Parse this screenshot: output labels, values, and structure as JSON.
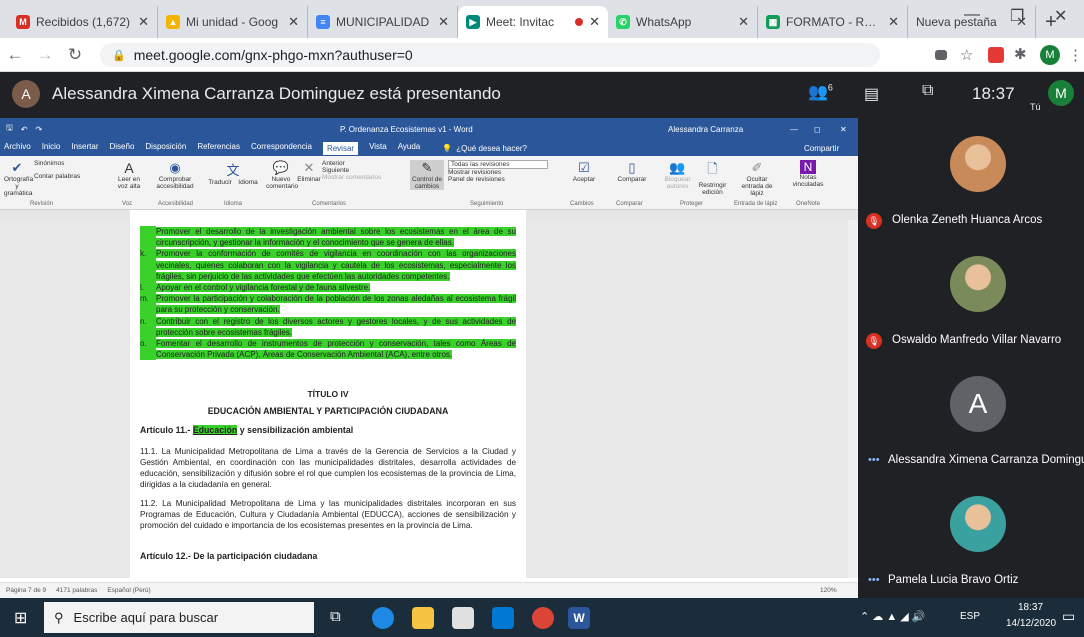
{
  "browser": {
    "tabs": [
      {
        "title": "Recibidos (1,672)",
        "icon": "gmail-icon",
        "color": "#d93025",
        "glyph": "M"
      },
      {
        "title": "Mi unidad - Goog",
        "icon": "drive-icon",
        "color": "#f4b400",
        "glyph": "▲"
      },
      {
        "title": "MUNICIPALIDAD",
        "icon": "docs-icon",
        "color": "#4285f4",
        "glyph": "≡"
      },
      {
        "title": "Meet: Invitac",
        "icon": "meet-icon",
        "color": "#00897b",
        "glyph": "▶"
      },
      {
        "title": "WhatsApp",
        "icon": "whatsapp-icon",
        "color": "#25d366",
        "glyph": "✆"
      },
      {
        "title": "FORMATO - REND",
        "icon": "sheets-icon",
        "color": "#0f9d58",
        "glyph": "▦"
      },
      {
        "title": "Nueva pestaña",
        "icon": "",
        "color": "",
        "glyph": ""
      }
    ],
    "url": "meet.google.com/gnx-phgo-mxn?authuser=0",
    "profile_letter": "M"
  },
  "meet": {
    "presenter_initial": "A",
    "presenting_text": "Alessandra Ximena Carranza Dominguez está presentando",
    "people_count": "6",
    "time": "18:37",
    "self_letter": "M",
    "self_label": "Tú"
  },
  "word": {
    "title": "P. Ordenanza Ecosistemas v1 - Word",
    "user": "Alessandra Carranza",
    "share": "Compartir",
    "menu": [
      "Archivo",
      "Inicio",
      "Insertar",
      "Diseño",
      "Disposición",
      "Referencias",
      "Correspondencia",
      "Revisar",
      "Vista",
      "Ayuda"
    ],
    "active_menu": "Revisar",
    "tell_me": "¿Qué desea hacer?",
    "ribbon": {
      "spelling": "Ortografía y gramática",
      "synonyms": "Sinónimos",
      "word_count": "Contar palabras",
      "group_review": "Revisión",
      "read_aloud": "Leer en voz alta",
      "group_voice": "Voz",
      "check_access": "Comprobar accesibilidad",
      "group_access": "Accesibilidad",
      "translate": "Traducir",
      "language": "Idioma",
      "group_lang": "Idioma",
      "new_comment": "Nuevo comentario",
      "delete": "Eliminar",
      "previous": "Anterior",
      "next": "Siguiente",
      "show_comments": "Mostrar comentarios",
      "group_comments": "Comentarios",
      "track": "Control de cambios",
      "all_revisions": "Todas las revisiones",
      "show_markup": "Mostrar revisiones",
      "review_pane": "Panel de revisiones",
      "group_tracking": "Seguimiento",
      "accept": "Aceptar",
      "group_changes": "Cambios",
      "compare": "Comparar",
      "group_compare": "Comparar",
      "block_authors": "Bloquear autores",
      "restrict": "Restringir edición",
      "group_protect": "Proteger",
      "hide_ink": "Ocultar entrada de lápiz",
      "group_ink": "Entrada de lápiz",
      "linked_notes": "Notas vinculadas",
      "group_onenote": "OneNote"
    },
    "highlighted_items": [
      {
        "n": "",
        "text": "Promover el desarrollo de la investigación ambiental sobre los ecosistemas en el área de su circunscripción, y gestionar la información y el conocimiento que se genera de ellas."
      },
      {
        "n": "k.",
        "text": "Promover la conformación de comités de vigilancia en coordinación con las organizaciones vecinales, quienes colaboran con la vigilancia y cautela de los ecosistemas, especialmente los frágiles, sin perjuicio de las actividades que efectúen las autoridades competentes."
      },
      {
        "n": "l.",
        "text": "Apoyar en el control y vigilancia forestal y de fauna silvestre."
      },
      {
        "n": "m.",
        "text": "Promover la participación y colaboración de la población de los zonas aledañas al ecosistema frágil para su protección y conservación."
      },
      {
        "n": "n.",
        "text": "Contribuir con el registro de los diversos actores y gestores locales, y de sus actividades de protección sobre ecosistemas frágiles."
      },
      {
        "n": "o.",
        "text": "Fomentar el desarrollo de instrumentos de protección y conservación, tales como Áreas de Conservación Privada (ACP), Áreas de Conservación Ambiental (ACA), entre otros."
      }
    ],
    "titulo": "TÍTULO IV",
    "heading": "EDUCACIÓN AMBIENTAL Y PARTICIPACIÓN CIUDADANA",
    "article_prefix": "Artículo 11.-",
    "article_underlined": "Educación",
    "article_rest": "y sensibilización ambiental",
    "para1": "11.1. La Municipalidad Metropolitana de Lima a través de la Gerencia de Servicios a la Ciudad y Gestión Ambiental, en coordinación con las municipalidades distritales, desarrolla actividades de educación, sensibilización y difusión sobre el rol que cumplen los ecosistemas de la provincia de Lima, dirigidas a la ciudadanía en general.",
    "para2": "11.2. La Municipalidad Metropolitana de Lima y las municipalidades distritales incorporan en sus Programas de Educación, Cultura y Ciudadanía Ambiental (EDUCCA), acciones de sensibilización y promoción del cuidado e importancia de los ecosistemas presentes en la provincia de Lima.",
    "next_article": "Artículo 12.- De la participación ciudadana",
    "status": {
      "page": "Página 7 de 9",
      "words": "4171 palabras",
      "lang": "Español (Perú)",
      "zoom": "120%"
    }
  },
  "participants": [
    {
      "name": "Olenka Zeneth Huanca Arcos",
      "muted": true,
      "type": "photo",
      "color": "#c98a5a"
    },
    {
      "name": "Oswaldo Manfredo Villar Navarro",
      "muted": true,
      "type": "photo",
      "color": "#7a8a5a"
    },
    {
      "name": "Alessandra Ximena Carranza Domingu...",
      "muted": false,
      "type": "letter",
      "letter": "A",
      "color": "#5f6368"
    },
    {
      "name": "Pamela Lucia Bravo Ortiz",
      "muted": false,
      "type": "photo",
      "color": "#3aa0a0"
    }
  ],
  "taskbar": {
    "search_placeholder": "Escribe aquí para buscar",
    "lang": "ESP",
    "time": "18:37",
    "date": "14/12/2020"
  }
}
